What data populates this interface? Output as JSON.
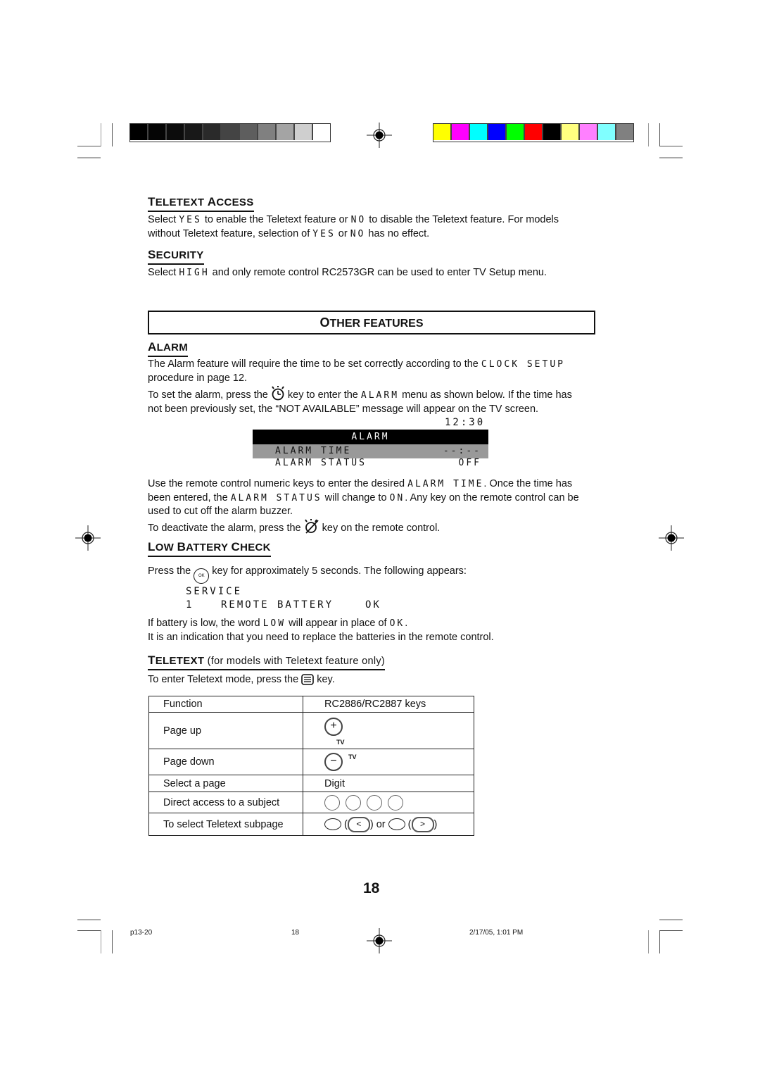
{
  "color_bars": {
    "grayscale": [
      "#000000",
      "#050505",
      "#0c0c0c",
      "#181818",
      "#2a2a2a",
      "#444444",
      "#5e5e5e",
      "#808080",
      "#a4a4a4",
      "#cfcfcf",
      "#ffffff"
    ],
    "colors": [
      "#ffff00",
      "#ff00ff",
      "#00ffff",
      "#0000ff",
      "#00ff00",
      "#ff0000",
      "#000000",
      "#ffff80",
      "#ff80ff",
      "#80ffff",
      "#808080"
    ]
  },
  "teletext_access": {
    "heading_first": "T",
    "heading_rest": "ELETEXT ",
    "heading_first2": "A",
    "heading_rest2": "CCESS",
    "line1_a": "Select ",
    "line1_yes": "YES",
    "line1_b": " to enable the Teletext feature or ",
    "line1_no": "NO",
    "line1_c": " to disable the Teletext feature. For models",
    "line2_a": "without Teletext feature, selection of ",
    "line2_yes": "YES",
    "line2_b": " or ",
    "line2_no": "NO",
    "line2_c": " has no effect."
  },
  "security": {
    "heading_first": "S",
    "heading_rest": "ECURITY",
    "text_a": "Select ",
    "text_high": "HIGH",
    "text_b": " and only remote control RC2573GR can be used to enter TV Setup menu."
  },
  "other_features": {
    "first": "O",
    "rest": "THER FEATURES"
  },
  "alarm": {
    "heading_first": "A",
    "heading_rest": "LARM",
    "p1_a": "The Alarm feature will require the time to be set correctly according to the ",
    "p1_code": "CLOCK SETUP",
    "p1_b": "procedure in page 12.",
    "p2_a": "To set the alarm, press the ",
    "p2_b": " key to enter the ",
    "p2_code": "ALARM",
    "p2_c": " menu as shown below. If the time has",
    "p2_d": "not been previously set, the “NOT  AVAILABLE” message will appear on the TV screen.",
    "menu": {
      "clock": "12:30",
      "title": "ALARM",
      "rows": [
        {
          "label": "ALARM TIME",
          "value": "--:--",
          "selected": true
        },
        {
          "label": "ALARM STATUS",
          "value": "OFF",
          "selected": false
        }
      ]
    },
    "p3_a": "Use the remote control numeric keys to enter the desired ",
    "p3_code1": "ALARM TIME",
    "p3_b": ". Once the time has",
    "p3_c": "been entered, the ",
    "p3_code2": "ALARM STATUS",
    "p3_d": " will change to ",
    "p3_code3": "ON",
    "p3_e": ". Any key on the remote control can be",
    "p3_f": "used to cut off the alarm buzzer.",
    "p4_a": "To deactivate the alarm, press the ",
    "p4_b": " key on the remote control."
  },
  "low_battery": {
    "h1": "L",
    "h1r": "OW ",
    "h2": "B",
    "h2r": "ATTERY ",
    "h3": "C",
    "h3r": "HECK",
    "p1_a": "Press the ",
    "ok_key": "OK",
    "p1_b": " key for approximately 5 seconds.  The following appears:",
    "service": "SERVICE",
    "row_num": "1",
    "row_label": "REMOTE BATTERY",
    "row_value": "OK",
    "p2_a": "If battery is low, the word ",
    "p2_low": "LOW",
    "p2_b": " will appear in place of ",
    "p2_ok": "OK",
    "p2_c": ".",
    "p3": "It is an indication that you need to replace the batteries in the remote control."
  },
  "teletext": {
    "h1": "T",
    "h1r": "ELETEXT",
    "note": " (for models with Teletext feature only)",
    "p1_a": "To enter Teletext mode, press the ",
    "p1_b": " key.",
    "table": {
      "headers": [
        "Function",
        "RC2886/RC2887 keys"
      ],
      "rows": [
        {
          "function": "Page up",
          "key": "+",
          "tv": "TV"
        },
        {
          "function": "Page down",
          "key": "−",
          "tv": "TV"
        },
        {
          "function": "Select a page",
          "key": "Digit"
        },
        {
          "function": "Direct access to a subject",
          "key": ""
        },
        {
          "function": "To select Teletext subpage",
          "left": "<",
          "or": " or ",
          "right": ">"
        }
      ]
    }
  },
  "page_number": "18",
  "footer": {
    "file": "p13-20",
    "page": "18",
    "datetime": "2/17/05, 1:01 PM"
  }
}
